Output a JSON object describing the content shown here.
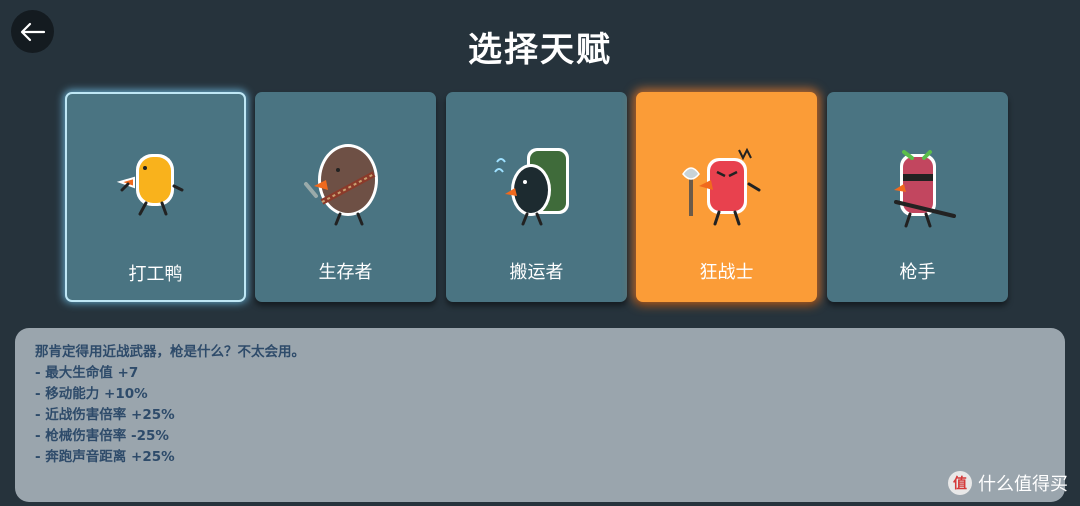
{
  "header": {
    "title": "选择天赋"
  },
  "talents": [
    {
      "label": "打工鸭"
    },
    {
      "label": "生存者"
    },
    {
      "label": "搬运者"
    },
    {
      "label": "狂战士"
    },
    {
      "label": "枪手"
    }
  ],
  "description": {
    "lines": [
      "那肯定得用近战武器，枪是什么？不太会用。",
      "- 最大生命值 +7",
      "- 移动能力 +10%",
      "- 近战伤害倍率 +25%",
      "- 枪械伤害倍率 -25%",
      "- 奔跑声音距离 +25%"
    ]
  },
  "watermark": {
    "badge": "值",
    "text": "什么值得买"
  },
  "colors": {
    "background": "#26333c",
    "card": "#4a7482",
    "card_selected": "#fb9c37",
    "panel": "#9aa5ad",
    "panel_text": "#2e4b6a"
  }
}
